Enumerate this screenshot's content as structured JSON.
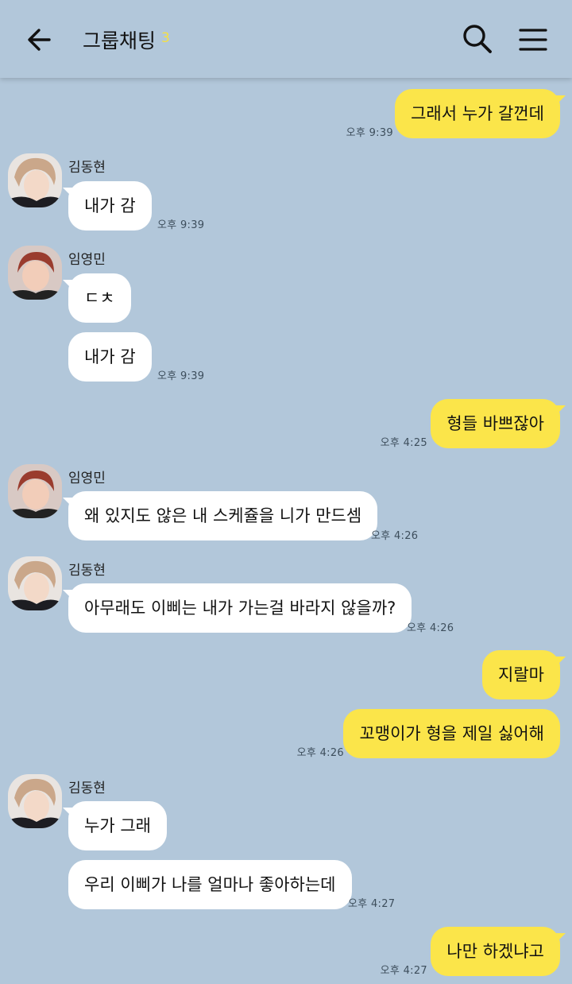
{
  "header": {
    "title": "그룹채팅",
    "member_count": "3"
  },
  "icons": {
    "back": "arrow-left-icon",
    "search": "search-icon",
    "menu": "hamburger-menu-icon"
  },
  "colors": {
    "background": "#b2c7da",
    "outgoing_bubble": "#fbe54a",
    "incoming_bubble": "#ffffff",
    "member_count": "#f5e043"
  },
  "messages": [
    {
      "direction": "out",
      "text": "그래서 누가 갈껀데",
      "time": "오후 9:39"
    },
    {
      "direction": "in",
      "sender": "김동현",
      "text": "내가 감",
      "time": "오후 9:39"
    },
    {
      "direction": "in",
      "sender": "임영민",
      "text": "ㄷㅊ"
    },
    {
      "direction": "in",
      "text": "내가 감",
      "time": "오후 9:39"
    },
    {
      "direction": "out",
      "text": "형들 바쁘잖아",
      "time": "오후 4:25"
    },
    {
      "direction": "in",
      "sender": "임영민",
      "text": "왜 있지도 않은 내 스케쥴을 니가 만드셈",
      "time": "오후 4:26"
    },
    {
      "direction": "in",
      "sender": "김동현",
      "text": "아무래도 이삐는 내가 가는걸 바라지 않을까?",
      "time": "오후 4:26"
    },
    {
      "direction": "out",
      "text": "지랄마"
    },
    {
      "direction": "out",
      "text": "꼬맹이가 형을 제일 싫어해",
      "time": "오후 4:26"
    },
    {
      "direction": "in",
      "sender": "김동현",
      "text": "누가 그래"
    },
    {
      "direction": "in",
      "text": "우리 이삐가 나를 얼마나 좋아하는데",
      "time": "오후 4:27"
    },
    {
      "direction": "out",
      "text": "나만 하겠냐고",
      "time": "오후 4:27"
    }
  ]
}
